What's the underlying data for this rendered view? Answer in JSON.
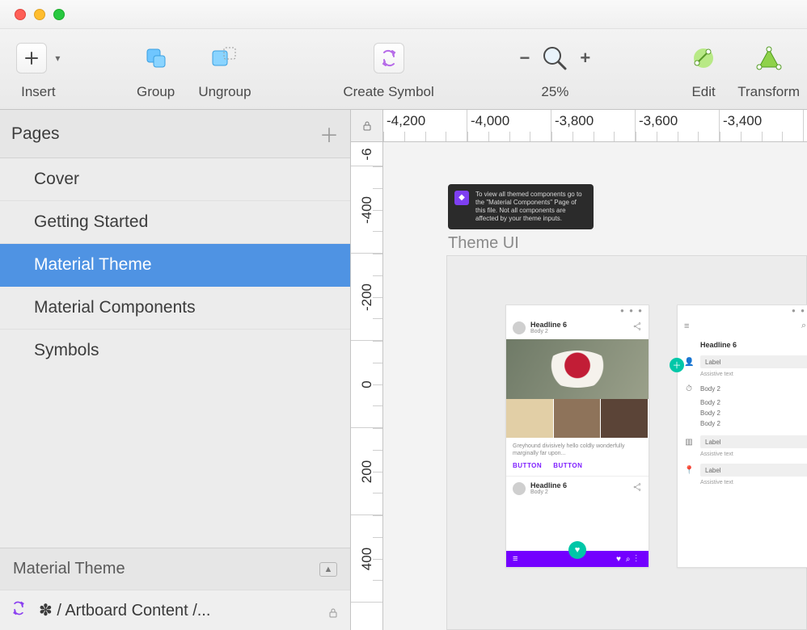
{
  "toolbar": {
    "insert": "Insert",
    "group": "Group",
    "ungroup": "Ungroup",
    "create_symbol": "Create Symbol",
    "zoom_pct": "25%",
    "edit": "Edit",
    "transform": "Transform"
  },
  "sidebar": {
    "pages_label": "Pages",
    "pages": [
      {
        "name": "Cover",
        "selected": false
      },
      {
        "name": "Getting Started",
        "selected": false
      },
      {
        "name": "Material Theme",
        "selected": true
      },
      {
        "name": "Material Components",
        "selected": false
      },
      {
        "name": "Symbols",
        "selected": false
      }
    ],
    "footer_title": "Material Theme",
    "footer_item": "✽ / Artboard Content /..."
  },
  "ruler": {
    "top_labels": [
      "-4,200",
      "-4,000",
      "-3,800",
      "-3,600",
      "-3,400"
    ],
    "left_labels": [
      "-6",
      "-400",
      "-200",
      "0",
      "200",
      "400"
    ]
  },
  "canvas": {
    "tip_text": "To view all themed components go to the \"Material Components\" Page of this file. Not all components are affected by your theme inputs.",
    "section_label": "Theme UI",
    "mockA": {
      "headline": "Headline 6",
      "body": "Body 2",
      "caption": "Greyhound divisively hello coldly wonderfully marginally far upon...",
      "button": "BUTTON",
      "headline2": "Headline 6",
      "body2b": "Body 2"
    },
    "mockB": {
      "headline": "Headline 6",
      "label": "Label",
      "assistive": "Assistive text",
      "body2": "Body 2"
    }
  }
}
